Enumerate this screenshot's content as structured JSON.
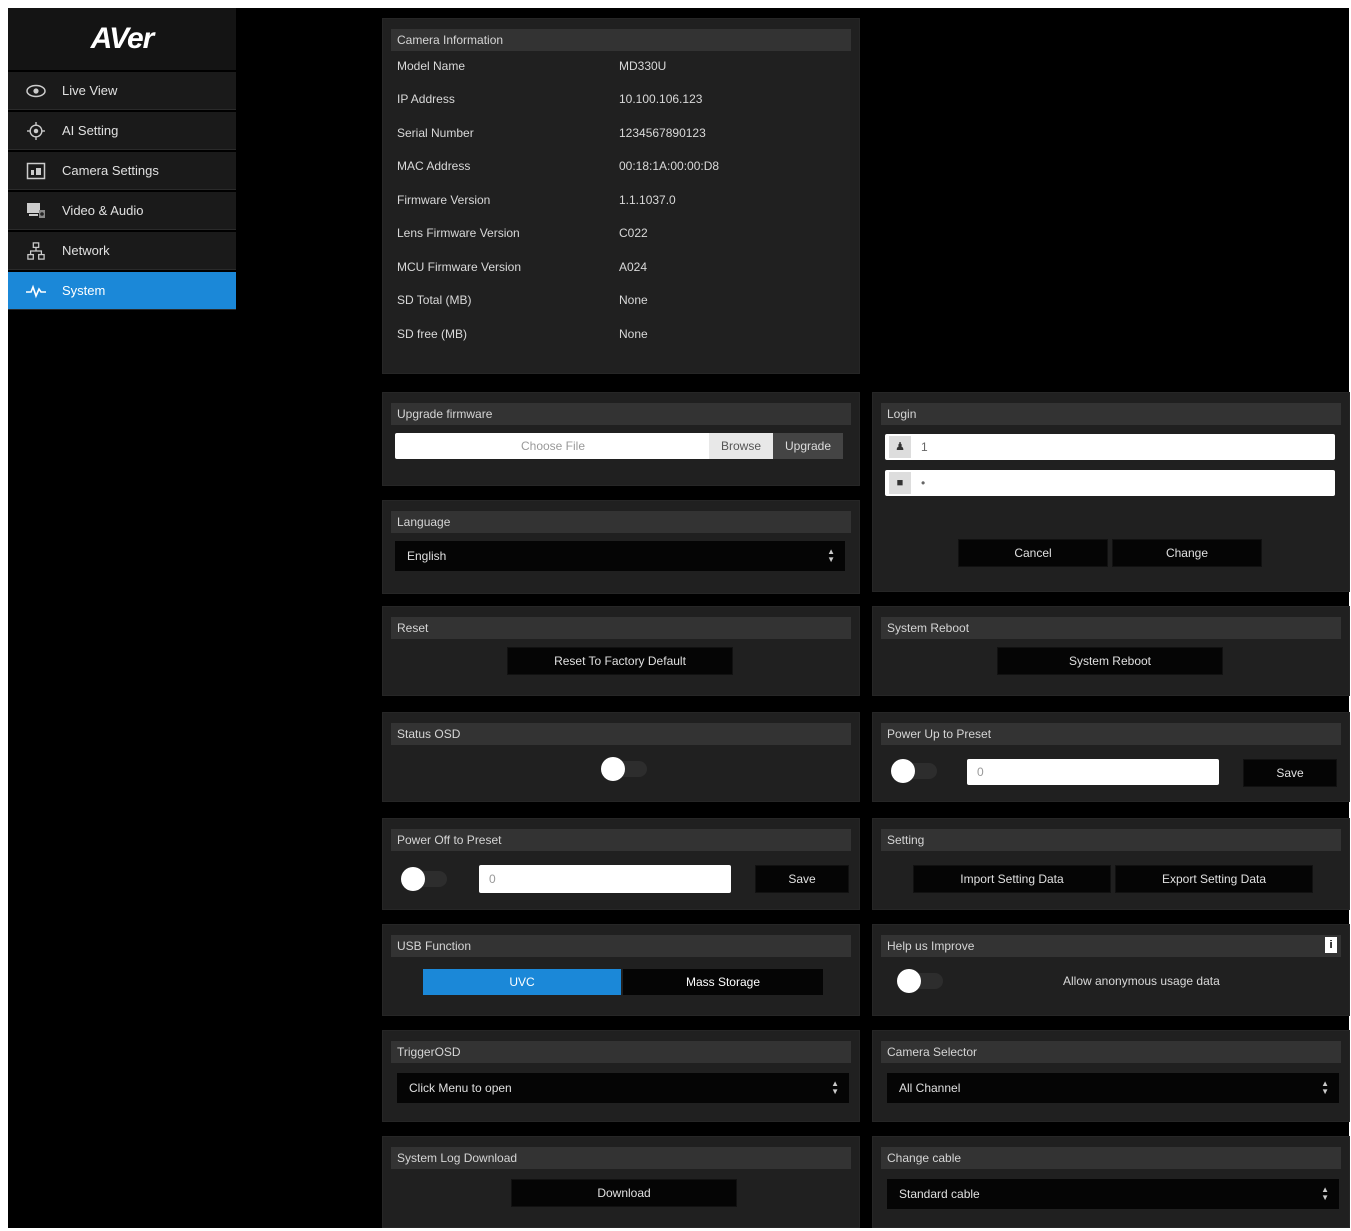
{
  "app": {
    "logo": "AVer"
  },
  "sidebar": {
    "items": [
      {
        "label": "Live View",
        "icon": "eye-icon"
      },
      {
        "label": "AI Setting",
        "icon": "target-icon"
      },
      {
        "label": "Camera Settings",
        "icon": "camera-settings-icon"
      },
      {
        "label": "Video & Audio",
        "icon": "video-audio-icon"
      },
      {
        "label": "Network",
        "icon": "network-icon"
      },
      {
        "label": "System",
        "icon": "pulse-icon",
        "active": true
      }
    ]
  },
  "camera_info": {
    "title": "Camera Information",
    "rows": [
      {
        "label": "Model Name",
        "value": "MD330U"
      },
      {
        "label": "IP Address",
        "value": "10.100.106.123"
      },
      {
        "label": "Serial Number",
        "value": "1234567890123"
      },
      {
        "label": "MAC Address",
        "value": "00:18:1A:00:00:D8"
      },
      {
        "label": "Firmware Version",
        "value": "1.1.1037.0"
      },
      {
        "label": "Lens Firmware Version",
        "value": "C022"
      },
      {
        "label": "MCU Firmware Version",
        "value": "A024"
      },
      {
        "label": "SD Total (MB)",
        "value": "None"
      },
      {
        "label": "SD free (MB)",
        "value": "None"
      }
    ]
  },
  "upgrade": {
    "title": "Upgrade firmware",
    "file_placeholder": "Choose File",
    "browse_label": "Browse",
    "upgrade_label": "Upgrade"
  },
  "login": {
    "title": "Login",
    "username_value": "1",
    "password_value": "•",
    "cancel_label": "Cancel",
    "change_label": "Change"
  },
  "language": {
    "title": "Language",
    "selected": "English"
  },
  "reset": {
    "title": "Reset",
    "button_label": "Reset To Factory Default"
  },
  "reboot": {
    "title": "System Reboot",
    "button_label": "System Reboot"
  },
  "status_osd": {
    "title": "Status OSD"
  },
  "power_up": {
    "title": "Power Up to Preset",
    "value": "0",
    "save_label": "Save"
  },
  "power_off": {
    "title": "Power Off to Preset",
    "value": "0",
    "save_label": "Save"
  },
  "setting": {
    "title": "Setting",
    "import_label": "Import Setting Data",
    "export_label": "Export Setting Data"
  },
  "usb": {
    "title": "USB Function",
    "uvc_label": "UVC",
    "mass_label": "Mass Storage",
    "active_color": "#1b88d8"
  },
  "help": {
    "title": "Help us Improve",
    "text": "Allow anonymous usage data"
  },
  "trigger_osd": {
    "title": "TriggerOSD",
    "selected": "Click Menu to open"
  },
  "camera_selector": {
    "title": "Camera Selector",
    "selected": "All Channel"
  },
  "log": {
    "title": "System Log Download",
    "button_label": "Download"
  },
  "cable": {
    "title": "Change cable",
    "selected": "Standard cable"
  }
}
